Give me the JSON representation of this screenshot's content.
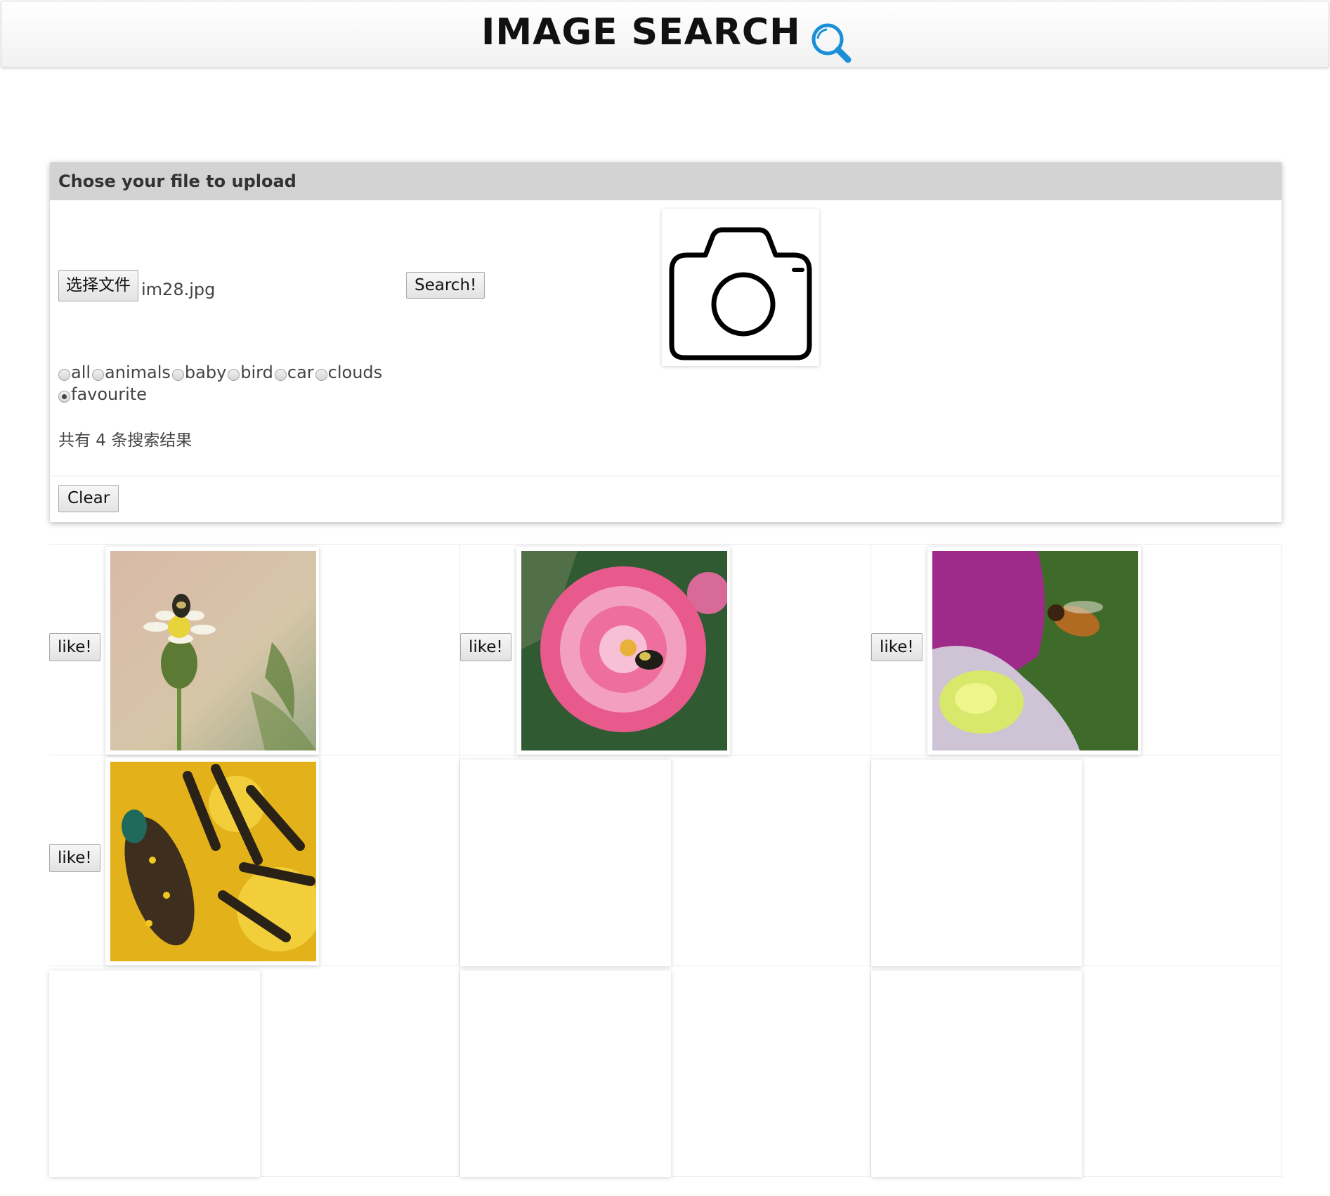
{
  "header": {
    "title": "IMAGE SEARCH",
    "icon": "search-icon",
    "icon_color": "#1a8fd8"
  },
  "upload_panel": {
    "heading": "Chose your file to upload",
    "file_button_label": "选择文件",
    "file_name": "im28.jpg",
    "search_button_label": "Search!",
    "preview_icon": "camera-icon",
    "categories": [
      {
        "label": "all",
        "checked": false
      },
      {
        "label": "animals",
        "checked": false
      },
      {
        "label": "baby",
        "checked": false
      },
      {
        "label": "bird",
        "checked": false
      },
      {
        "label": "car",
        "checked": false
      },
      {
        "label": "clouds",
        "checked": false
      },
      {
        "label": "favourite",
        "checked": true
      }
    ],
    "result_count_text": "共有 4 条搜索结果",
    "clear_button_label": "Clear"
  },
  "results": [
    {
      "like_label": "like!",
      "image": "bee-on-white-flower-photo"
    },
    {
      "like_label": "like!",
      "image": "bee-on-pink-dahlia-photo"
    },
    {
      "like_label": "like!",
      "image": "bee-flying-to-flower-photo"
    },
    {
      "like_label": "like!",
      "image": "beetle-on-yellow-flower-photo"
    }
  ],
  "empty_slots": 5
}
